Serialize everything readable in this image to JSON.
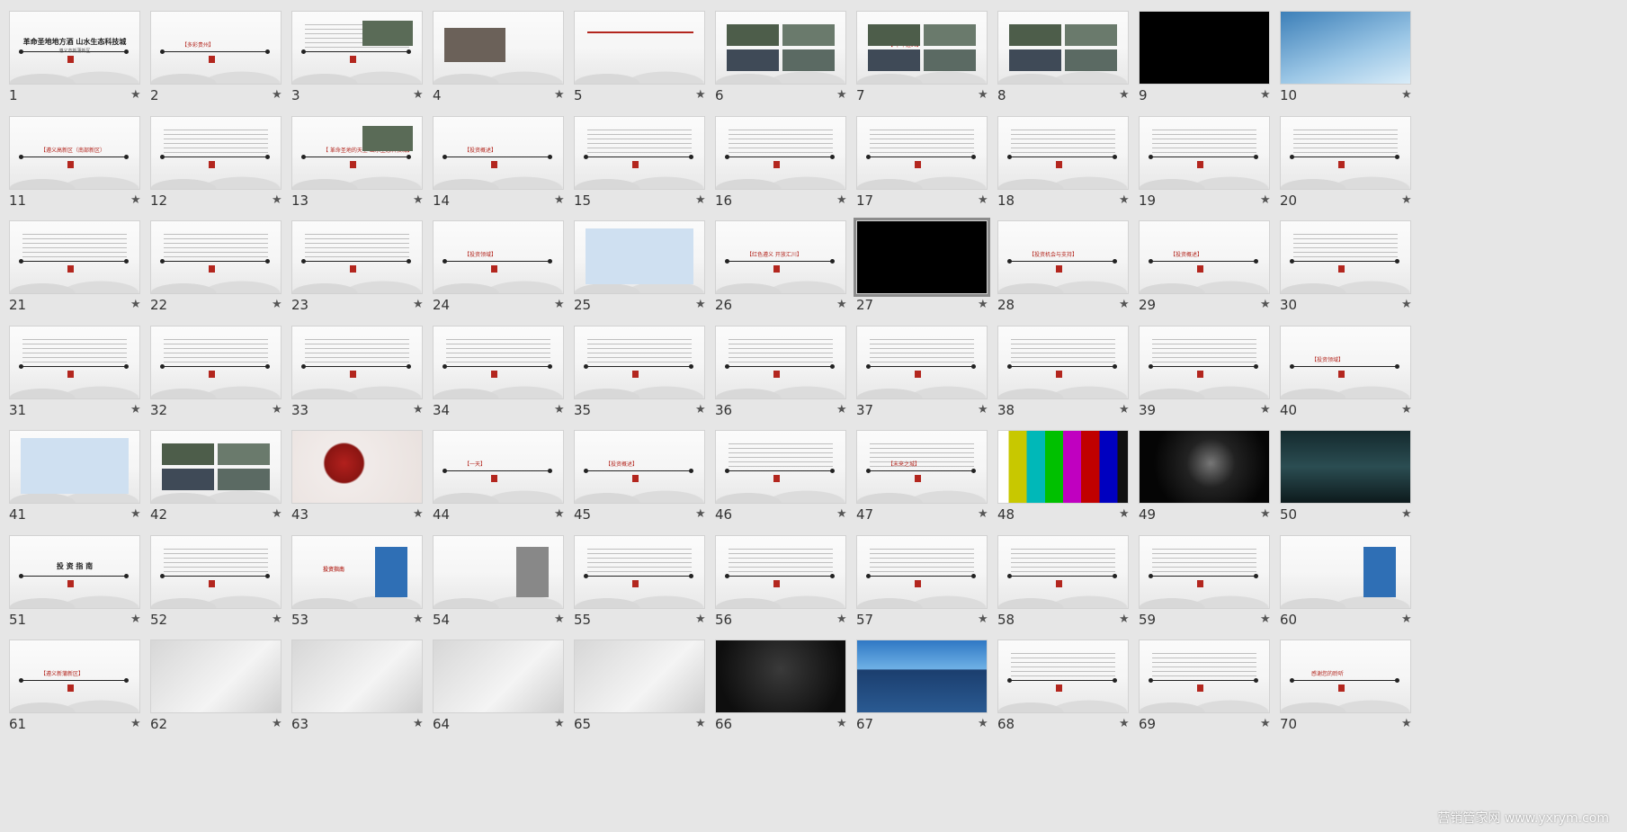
{
  "slides": [
    {
      "number": "1",
      "type": "cover",
      "title": "革命圣地地方酒 山水生态科技城",
      "subtitle": "遵义市新蒲新区",
      "star": "★"
    },
    {
      "number": "2",
      "type": "section",
      "title": "【多彩贵州】",
      "star": "★"
    },
    {
      "number": "3",
      "type": "text-photo",
      "title": "",
      "star": "★"
    },
    {
      "number": "4",
      "type": "group-photo",
      "title": "",
      "star": "★"
    },
    {
      "number": "5",
      "type": "org-chart",
      "title": "",
      "star": "★"
    },
    {
      "number": "6",
      "type": "photo-grid",
      "title": "",
      "star": "★"
    },
    {
      "number": "7",
      "type": "photo-grid",
      "title": "【 千年遵义】",
      "star": "★"
    },
    {
      "number": "8",
      "type": "photo-grid",
      "title": "",
      "star": "★"
    },
    {
      "number": "9",
      "type": "black",
      "title": "",
      "star": "★"
    },
    {
      "number": "10",
      "type": "sky",
      "title": "",
      "star": "★"
    },
    {
      "number": "11",
      "type": "section",
      "title": "【遵义高新区（南部新区）",
      "star": "★"
    },
    {
      "number": "12",
      "type": "text",
      "title": "",
      "star": "★"
    },
    {
      "number": "13",
      "type": "section-photo",
      "title": "【 革命圣地的天空 山水生态科技城】",
      "star": "★"
    },
    {
      "number": "14",
      "type": "section",
      "title": "【投资概述】",
      "star": "★"
    },
    {
      "number": "15",
      "type": "text",
      "title": "",
      "star": "★"
    },
    {
      "number": "16",
      "type": "text",
      "title": "",
      "star": "★"
    },
    {
      "number": "17",
      "type": "text",
      "title": "",
      "star": "★"
    },
    {
      "number": "18",
      "type": "text",
      "title": "",
      "star": "★"
    },
    {
      "number": "19",
      "type": "text",
      "title": "",
      "star": "★"
    },
    {
      "number": "20",
      "type": "text",
      "title": "",
      "star": "★"
    },
    {
      "number": "21",
      "type": "text",
      "title": "",
      "star": "★"
    },
    {
      "number": "22",
      "type": "text",
      "title": "",
      "star": "★"
    },
    {
      "number": "23",
      "type": "text",
      "title": "",
      "star": "★"
    },
    {
      "number": "24",
      "type": "section",
      "title": "【投资领域】",
      "star": "★"
    },
    {
      "number": "25",
      "type": "table",
      "title": "",
      "star": "★"
    },
    {
      "number": "26",
      "type": "section",
      "title": "【红色遵义 开放汇川】",
      "star": "★"
    },
    {
      "number": "27",
      "type": "black",
      "title": "",
      "star": "★",
      "selected": true
    },
    {
      "number": "28",
      "type": "section",
      "title": "【投资机会与支持】",
      "star": "★"
    },
    {
      "number": "29",
      "type": "section",
      "title": "【投资概述】",
      "star": "★"
    },
    {
      "number": "30",
      "type": "text",
      "title": "",
      "star": "★"
    },
    {
      "number": "31",
      "type": "text",
      "title": "",
      "star": "★"
    },
    {
      "number": "32",
      "type": "text",
      "title": "",
      "star": "★"
    },
    {
      "number": "33",
      "type": "text",
      "title": "",
      "star": "★"
    },
    {
      "number": "34",
      "type": "text",
      "title": "",
      "star": "★"
    },
    {
      "number": "35",
      "type": "text",
      "title": "",
      "star": "★"
    },
    {
      "number": "36",
      "type": "text",
      "title": "",
      "star": "★"
    },
    {
      "number": "37",
      "type": "text",
      "title": "",
      "star": "★"
    },
    {
      "number": "38",
      "type": "text",
      "title": "",
      "star": "★"
    },
    {
      "number": "39",
      "type": "text",
      "title": "",
      "star": "★"
    },
    {
      "number": "40",
      "type": "section",
      "title": "【投资领域】",
      "star": "★"
    },
    {
      "number": "41",
      "type": "table",
      "title": "",
      "star": "★"
    },
    {
      "number": "42",
      "type": "photo-grid",
      "title": "",
      "star": "★"
    },
    {
      "number": "43",
      "type": "book",
      "title": "",
      "star": "★"
    },
    {
      "number": "44",
      "type": "section",
      "title": "【一天】",
      "star": "★"
    },
    {
      "number": "45",
      "type": "section",
      "title": "【投资概述】",
      "star": "★"
    },
    {
      "number": "46",
      "type": "text",
      "title": "",
      "star": "★"
    },
    {
      "number": "47",
      "type": "text",
      "title": "【未来之城】",
      "star": "★"
    },
    {
      "number": "48",
      "type": "colorbars",
      "title": "",
      "star": "★"
    },
    {
      "number": "49",
      "type": "space",
      "title": "",
      "star": "★"
    },
    {
      "number": "50",
      "type": "window",
      "title": "",
      "star": "★"
    },
    {
      "number": "51",
      "type": "cover",
      "title": "投 资 指 南",
      "subtitle": "",
      "star": "★"
    },
    {
      "number": "52",
      "type": "list",
      "title": "",
      "star": "★"
    },
    {
      "number": "53",
      "type": "guide",
      "title": "投资指南",
      "star": "★"
    },
    {
      "number": "54",
      "type": "guide-grey",
      "title": "",
      "star": "★"
    },
    {
      "number": "55",
      "type": "text",
      "title": "",
      "star": "★"
    },
    {
      "number": "56",
      "type": "text",
      "title": "",
      "star": "★"
    },
    {
      "number": "57",
      "type": "text",
      "title": "",
      "star": "★"
    },
    {
      "number": "58",
      "type": "text",
      "title": "",
      "star": "★"
    },
    {
      "number": "59",
      "type": "text",
      "title": "",
      "star": "★"
    },
    {
      "number": "60",
      "type": "guide",
      "title": "",
      "star": "★"
    },
    {
      "number": "61",
      "type": "section",
      "title": "【遵义新蒲新区】",
      "star": "★"
    },
    {
      "number": "62",
      "type": "brochure",
      "title": "",
      "star": "★"
    },
    {
      "number": "63",
      "type": "brochure",
      "title": "",
      "star": "★"
    },
    {
      "number": "64",
      "type": "brochure",
      "title": "",
      "star": "★"
    },
    {
      "number": "65",
      "type": "brochure",
      "title": "",
      "star": "★"
    },
    {
      "number": "66",
      "type": "dark3d",
      "title": "",
      "star": "★"
    },
    {
      "number": "67",
      "type": "building",
      "title": "",
      "star": "★"
    },
    {
      "number": "68",
      "type": "text",
      "title": "",
      "star": "★"
    },
    {
      "number": "69",
      "type": "text",
      "title": "",
      "star": "★"
    },
    {
      "number": "70",
      "type": "contact",
      "title": "感谢您的聆听",
      "star": "★"
    }
  ],
  "watermark": "营销管家网 www.yxrym.com",
  "colors": {
    "background": "#e6e6e6",
    "accent": "#b3261e",
    "selection": "#8c8c8c"
  }
}
